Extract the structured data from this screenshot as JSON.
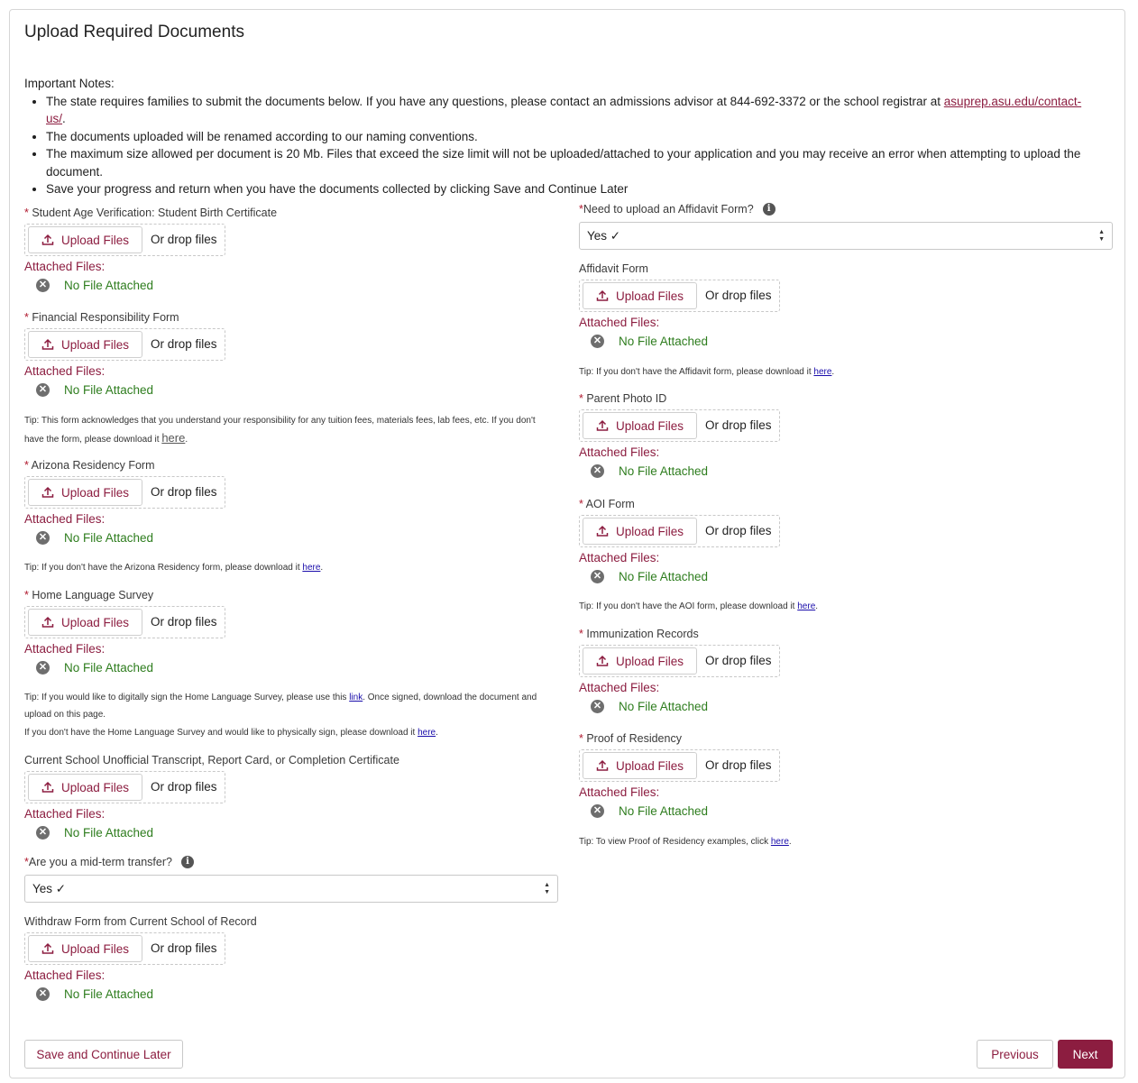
{
  "page": {
    "title": "Upload Required Documents"
  },
  "notes": {
    "heading": "Important Notes:",
    "item1_before": "The state requires families to submit the documents below. If you have any questions, please contact an admissions advisor at 844-692-3372 or the school registrar at ",
    "item1_link": "asuprep.asu.edu/contact-us/",
    "item1_after": ".",
    "item2": "The documents uploaded will be renamed according to our naming conventions.",
    "item3": "The maximum size allowed per document is 20 Mb. Files that exceed the size limit will not be uploaded/attached to your application and you may receive an error when attempting to upload the document.",
    "item4": "Save your progress and return when you have the documents collected by clicking Save and Continue Later"
  },
  "upload": {
    "button": "Upload Files",
    "drop": "Or drop files",
    "attached": "Attached Files:",
    "none": "No File Attached"
  },
  "left": {
    "birth_cert_label": "Student Age Verification: Student Birth Certificate",
    "financial_label": "Financial Responsibility Form",
    "financial_tip": "Tip: This form acknowledges that you understand your responsibility for any tuition fees, materials fees, lab fees, etc. If you don't have the form, please download it ",
    "financial_tip_link": "here",
    "residency_label": "Arizona Residency Form",
    "residency_tip": "Tip: If you don't have the Arizona Residency form, please download it ",
    "residency_tip_link": "here",
    "language_label": "Home Language Survey",
    "language_tip_a": "Tip: If you would like to digitally sign the Home Language Survey, please use this ",
    "language_tip_a_link": "link",
    "language_tip_a_after": ". Once signed, download the document and upload on this page.",
    "language_tip_b": "If you don't have the Home Language Survey and would like to physically sign, please download it ",
    "language_tip_b_link": "here",
    "transcript_label": "Current School Unofficial Transcript, Report Card, or Completion Certificate",
    "transfer_question": "Are you a mid-term transfer?",
    "transfer_value": "Yes ✓",
    "withdraw_label": "Withdraw Form from Current School of Record"
  },
  "right": {
    "affidavit_question": "Need to upload an Affidavit Form?",
    "affidavit_value": "Yes ✓",
    "affidavit_label": "Affidavit Form",
    "affidavit_tip": "Tip: If you don't have the Affidavit form, please download it ",
    "affidavit_tip_link": "here",
    "parent_id_label": "Parent Photo ID",
    "aoi_label": "AOI Form",
    "aoi_tip": "Tip: If you don't have the AOI form, please download it ",
    "aoi_tip_link": "here",
    "immunization_label": "Immunization Records",
    "proof_label": "Proof of Residency",
    "proof_tip": "Tip: To view Proof of Residency examples, click ",
    "proof_tip_link": "here"
  },
  "footer": {
    "save_later": "Save and Continue Later",
    "previous": "Previous",
    "next": "Next"
  },
  "colors": {
    "brand": "#8c1d40",
    "success": "#2e7d1e",
    "required": "#b0192e"
  },
  "icons": {
    "upload": "upload-icon",
    "remove": "close-circle-icon",
    "info": "info-icon",
    "select": "select-arrows-icon"
  }
}
